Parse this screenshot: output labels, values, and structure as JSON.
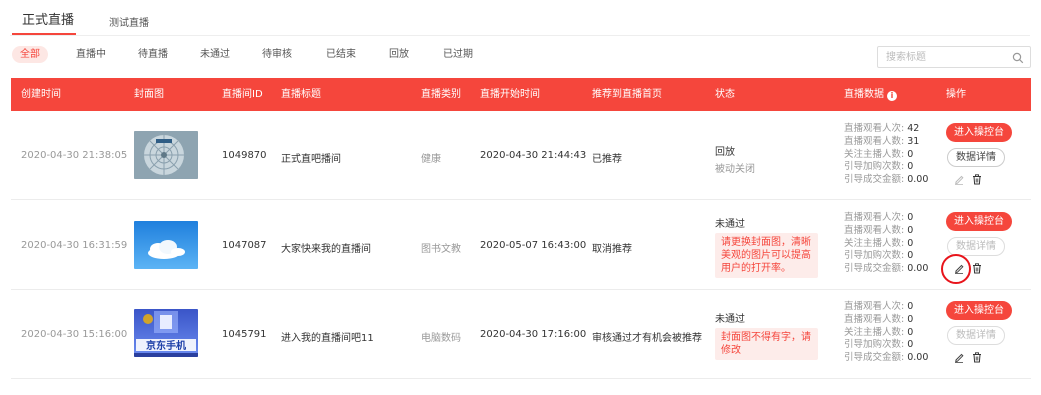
{
  "tabs": [
    {
      "label": "正式直播",
      "active": true
    },
    {
      "label": "测试直播",
      "active": false
    }
  ],
  "filters": [
    "全部",
    "直播中",
    "待直播",
    "未通过",
    "待审核",
    "已结束",
    "回放",
    "已过期"
  ],
  "active_filter": "全部",
  "search": {
    "placeholder": "搜索标题"
  },
  "columns": [
    "创建时间",
    "封面图",
    "直播间ID",
    "直播标题",
    "直播类别",
    "直播开始时间",
    "推荐到直播首页",
    "状态",
    "直播数据",
    "操作"
  ],
  "stat_labels": [
    "直播观看人次:",
    "直播观看人数:",
    "关注主播人数:",
    "引导加购次数:",
    "引导成交金额:"
  ],
  "buttons": {
    "enter_console": "进入操控台",
    "data_detail": "数据详情"
  },
  "rows": [
    {
      "created": "2020-04-30 21:38:05",
      "cover": "fan-image",
      "room_id": "1049870",
      "title": "正式直吧播间",
      "category": "健康",
      "start_time": "2020-04-30 21:44:43",
      "recommend": "已推荐",
      "status": "回放",
      "status_sub": "被动关闭",
      "reject_reason": "",
      "stats": [
        "42",
        "31",
        "0",
        "0",
        "0.00"
      ],
      "detail_enabled": true
    },
    {
      "created": "2020-04-30 16:31:59",
      "cover": "sky-image",
      "room_id": "1047087",
      "title": "大家快来我的直播间",
      "category": "图书文教",
      "start_time": "2020-05-07 16:43:00",
      "recommend": "取消推荐",
      "status": "未通过",
      "status_sub": "",
      "reject_reason": "请更换封面图，清晰美观的图片可以提高用户的打开率。",
      "stats": [
        "0",
        "0",
        "0",
        "0",
        "0.00"
      ],
      "detail_enabled": false
    },
    {
      "created": "2020-04-30 15:16:00",
      "cover": "jd-phone-image",
      "cover_text": "京东手机",
      "room_id": "1045791",
      "title": "进入我的直播间吧11",
      "category": "电脑数码",
      "start_time": "2020-04-30 17:16:00",
      "recommend": "审核通过才有机会被推荐",
      "status": "未通过",
      "status_sub": "",
      "reject_reason": "封面图不得有字，请修改",
      "stats": [
        "0",
        "0",
        "0",
        "0",
        "0.00"
      ],
      "detail_enabled": false
    }
  ],
  "colors": {
    "accent": "#f5463c",
    "header_text": "#ffffff",
    "reject_bg": "#fdecea",
    "highlight_ring": "#e8141b"
  }
}
